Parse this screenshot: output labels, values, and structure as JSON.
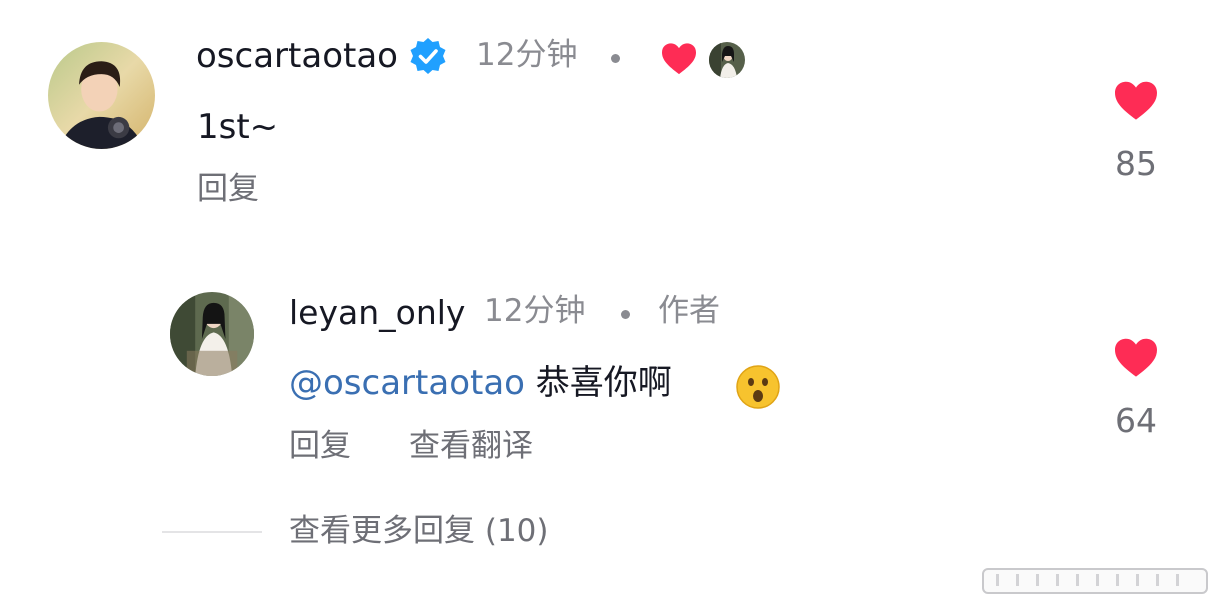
{
  "comments": [
    {
      "username": "oscartaotao",
      "verified": true,
      "time": "12分钟",
      "text": "1st~",
      "reply_label": "回复",
      "like_count": "85",
      "creator_liked": true
    }
  ],
  "reply": {
    "username": "leyan_only",
    "time": "12分钟",
    "author_tag": "作者",
    "mention": "@oscartaotao",
    "text": "恭喜你啊",
    "emoji": "😮",
    "reply_label": "回复",
    "translate_label": "查看翻译",
    "like_count": "64"
  },
  "view_more": "查看更多回复 (10)",
  "colors": {
    "like_red": "#fe2c55",
    "verified_blue": "#20a0ff",
    "mention_blue": "#3a6fb2"
  }
}
